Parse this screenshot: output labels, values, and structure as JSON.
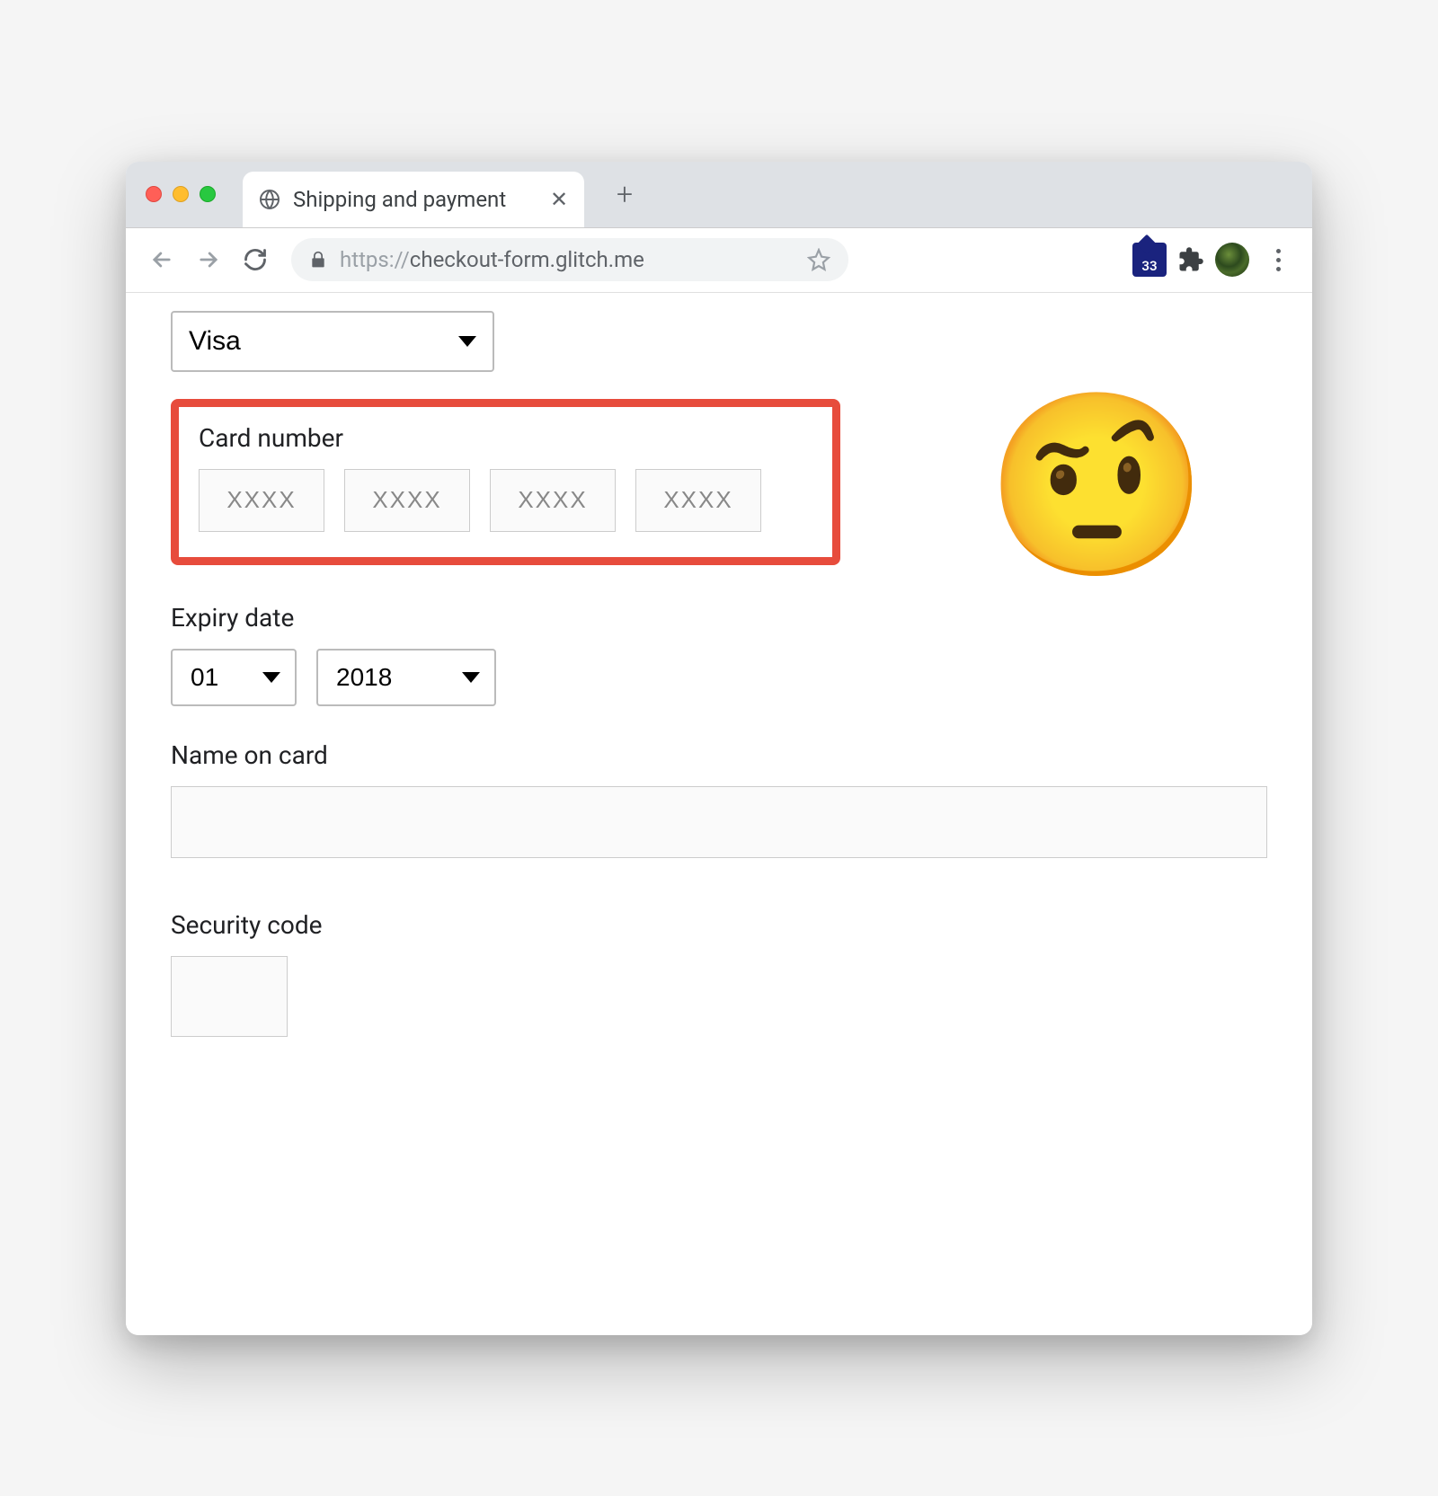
{
  "browser": {
    "tab_title": "Shipping and payment",
    "url_protocol": "https://",
    "url_rest": "checkout-form.glitch.me",
    "extension_badge": "33"
  },
  "form": {
    "card_type": {
      "selected": "Visa"
    },
    "card_number": {
      "label": "Card number",
      "placeholder": "XXXX"
    },
    "expiry": {
      "label": "Expiry date",
      "month": "01",
      "year": "2018"
    },
    "name": {
      "label": "Name on card",
      "value": ""
    },
    "cvv": {
      "label": "Security code",
      "value": ""
    }
  },
  "annotation": {
    "emoji": "🤨"
  }
}
